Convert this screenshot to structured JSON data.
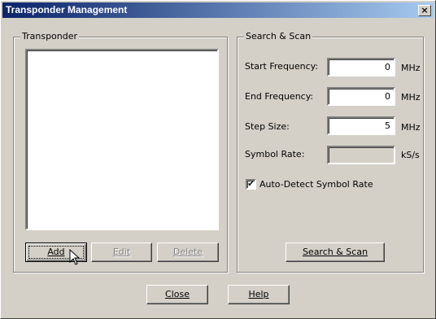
{
  "window": {
    "title": "Transponder Management",
    "close_glyph": "×"
  },
  "transponder_group": {
    "label": "Transponder",
    "buttons": {
      "add": "Add",
      "edit": "Edit",
      "delete": "Delete"
    }
  },
  "scan_group": {
    "label": "Search & Scan",
    "start_frequency": {
      "label": "Start Frequency:",
      "value": "0",
      "unit": "MHz"
    },
    "end_frequency": {
      "label": "End Frequency:",
      "value": "0",
      "unit": "MHz"
    },
    "step_size": {
      "label": "Step Size:",
      "value": "5",
      "unit": "MHz"
    },
    "symbol_rate": {
      "label": "Symbol Rate:",
      "value": "",
      "unit": "kS/s"
    },
    "auto_detect": {
      "label": "Auto-Detect Symbol Rate",
      "checked": true,
      "mark": "✔"
    },
    "scan_button": "Search & Scan"
  },
  "footer": {
    "close": "Close",
    "help": "Help"
  }
}
